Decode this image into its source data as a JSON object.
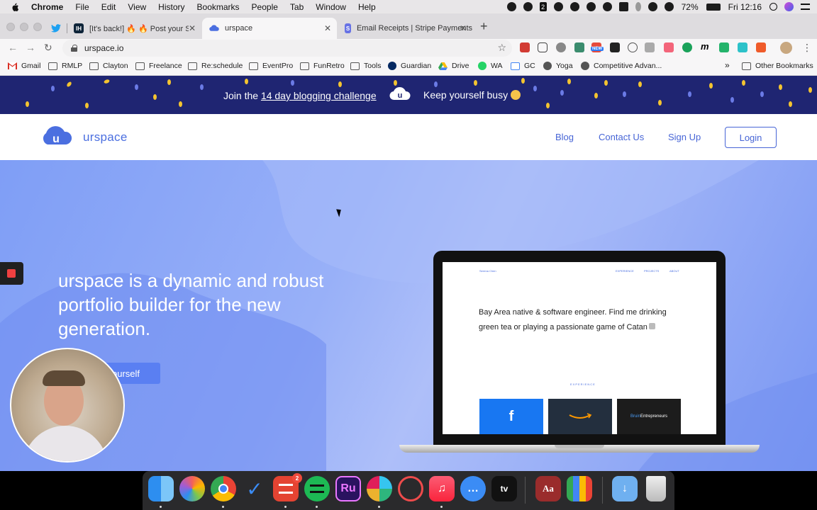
{
  "menubar": {
    "app": "Chrome",
    "items": [
      "File",
      "Edit",
      "View",
      "History",
      "Bookmarks",
      "People",
      "Tab",
      "Window",
      "Help"
    ],
    "battery": "72%",
    "clock": "Fri 12:16",
    "badge_number": "2"
  },
  "tabs": [
    {
      "title": "",
      "favicon": "twitter-icon"
    },
    {
      "title": "[It's back!] 🔥 🔥 Post your SAAS",
      "favicon": "ih-icon",
      "favicon_text": "IH"
    },
    {
      "title": "urspace",
      "favicon": "urspace-icon",
      "active": true
    },
    {
      "title": "Email Receipts | Stripe Payments",
      "favicon": "stripe-icon",
      "favicon_text": "S"
    }
  ],
  "toolbar": {
    "url": "urspace.io",
    "ext_new_label": "NEW"
  },
  "bookmarks": [
    {
      "label": "Gmail",
      "icon": "gmail-icon"
    },
    {
      "label": "RMLP",
      "icon": "folder-icon"
    },
    {
      "label": "Clayton",
      "icon": "folder-icon"
    },
    {
      "label": "Freelance",
      "icon": "folder-icon"
    },
    {
      "label": "Re:schedule",
      "icon": "folder-icon"
    },
    {
      "label": "EventPro",
      "icon": "folder-icon"
    },
    {
      "label": "FunRetro",
      "icon": "folder-icon"
    },
    {
      "label": "Tools",
      "icon": "folder-icon"
    },
    {
      "label": "Guardian",
      "icon": "guardian-icon"
    },
    {
      "label": "Drive",
      "icon": "drive-icon"
    },
    {
      "label": "WA",
      "icon": "whatsapp-icon"
    },
    {
      "label": "GC",
      "icon": "calendar-icon"
    },
    {
      "label": "Yoga",
      "icon": "globe-icon"
    },
    {
      "label": "Competitive Advan...",
      "icon": "globe-icon"
    }
  ],
  "bookmarks_more": "»",
  "other_bookmarks": "Other Bookmarks",
  "promo": {
    "prefix": "Join the ",
    "link": "14 day blogging challenge",
    "logo_letter": "u",
    "busy": "Keep yourself busy"
  },
  "site": {
    "brand": "urspace",
    "logo_letter": "u",
    "nav": [
      "Blog",
      "Contact Us",
      "Sign Up"
    ],
    "login": "Login"
  },
  "hero": {
    "title": "urspace is a dynamic and robust portfolio builder for the new generation.",
    "cta": "ourself"
  },
  "mockup": {
    "name": "Serena Chen",
    "nav": [
      "EXPERIENCE",
      "PROJECTS",
      "ABOUT"
    ],
    "bio": "Bay Area native & software engineer. Find me drinking green tea or playing a passionate game of Catan",
    "section": "EXPERIENCE",
    "cards": [
      {
        "label": "f",
        "color": "#1877f2"
      },
      {
        "label": "",
        "color": "#232f3e"
      },
      {
        "label_a": "Bruin",
        "label_b": "Entrepreneurs",
        "color": "#1c1c1c"
      }
    ]
  },
  "dock": {
    "apps": [
      {
        "name": "finder-icon",
        "color": "#3aa0f0",
        "text": ""
      },
      {
        "name": "photos-icon",
        "color": "#f2f2f2",
        "text": ""
      },
      {
        "name": "chrome-icon",
        "color": "#ffffff",
        "text": ""
      },
      {
        "name": "tasks-icon",
        "color": "#2a2a2c",
        "text": ""
      },
      {
        "name": "todoist-icon",
        "color": "#e44332",
        "text": "",
        "badge": "2"
      },
      {
        "name": "spotify-icon",
        "color": "#1db954",
        "text": ""
      },
      {
        "name": "rush-icon",
        "color": "#2a1360",
        "text": "Ru"
      },
      {
        "name": "slack-icon",
        "color": "#ffffff",
        "text": ""
      },
      {
        "name": "app-icon",
        "color": "#f2f2f2",
        "text": ""
      },
      {
        "name": "music-icon",
        "color": "#fb4f6a",
        "text": ""
      },
      {
        "name": "messenger-icon",
        "color": "#3b8cf5",
        "text": ""
      },
      {
        "name": "tv-icon",
        "color": "#111111",
        "text": "tv"
      },
      {
        "name": "dictionary-icon",
        "color": "#9a2c2c",
        "text": "Aa"
      },
      {
        "name": "numbers-icon",
        "color": "#f2f2f2",
        "text": ""
      },
      {
        "name": "downloads-icon",
        "color": "#6fb0f0",
        "text": ""
      },
      {
        "name": "trash-icon",
        "color": "#d5d5d5",
        "text": ""
      }
    ]
  }
}
